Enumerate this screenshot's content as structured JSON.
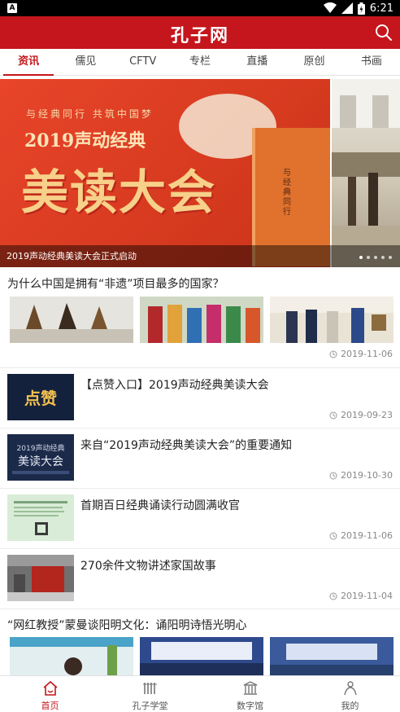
{
  "status": {
    "time": "6:21",
    "app_icon": "A"
  },
  "header": {
    "logo": "孔子网"
  },
  "tabs": [
    "资讯",
    "儒见",
    "CFTV",
    "专栏",
    "直播",
    "原创",
    "书画"
  ],
  "banner": {
    "slogan": "与经典同行 共筑中国梦",
    "sub_title": "2019声动经典",
    "big_title": "美读大会",
    "book_text": "与经典同行",
    "caption": "2019声动经典美读大会正式启动"
  },
  "feed": {
    "gallery1": {
      "title": "为什么中国是拥有“非遗”项目最多的国家？",
      "date": "2019-11-06"
    },
    "items": [
      {
        "title": "【点赞入口】2019声动经典美读大会",
        "date": "2019-09-23",
        "thumb_text": "点赞"
      },
      {
        "title": "来自“2019声动经典美读大会”的重要通知",
        "date": "2019-10-30",
        "thumb_text1": "2019声动经典",
        "thumb_text2": "美读大会"
      },
      {
        "title": "首期百日经典诵读行动圆满收官",
        "date": "2019-11-06"
      },
      {
        "title": "270余件文物讲述家国故事",
        "date": "2019-11-04"
      }
    ],
    "gallery2": {
      "title": "“网红教授”蒙曼谈阳明文化：诵阳明诗悟光明心"
    }
  },
  "nav": [
    "首页",
    "孔子学堂",
    "数字馆",
    "我的"
  ],
  "colors": {
    "brand": "#c4161c"
  }
}
